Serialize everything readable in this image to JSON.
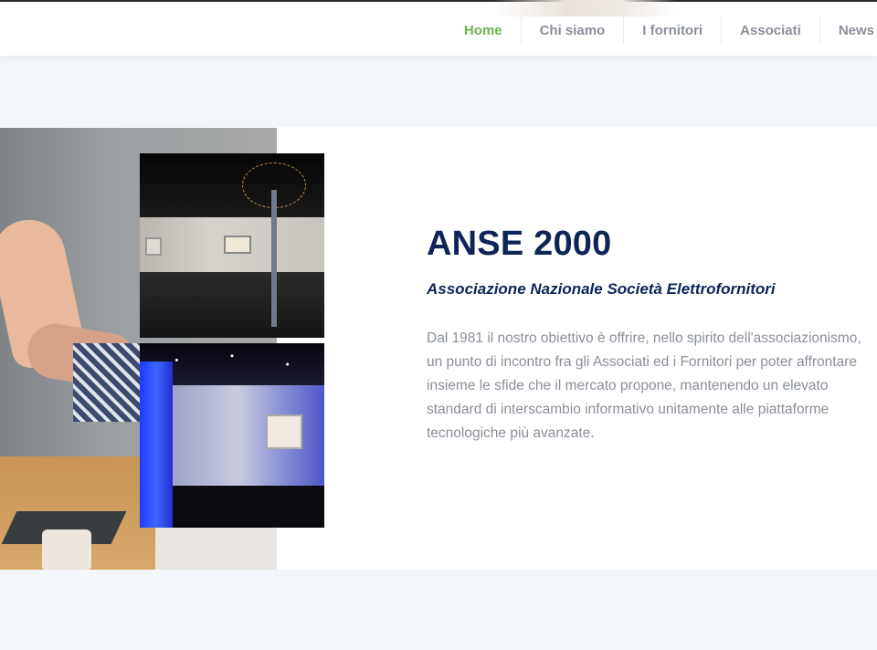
{
  "nav": {
    "items": [
      {
        "label": "Home",
        "active": true
      },
      {
        "label": "Chi siamo",
        "active": false
      },
      {
        "label": "I fornitori",
        "active": false
      },
      {
        "label": "Associati",
        "active": false
      },
      {
        "label": "News",
        "active": false
      }
    ],
    "active_color": "#6bb34d",
    "text_color": "#8a8f99"
  },
  "hero": {
    "title": "ANSE 2000",
    "subtitle": "Associazione Nazionale Società Elettrofornitori",
    "body": "Dal 1981 il nostro obiettivo è offrire, nello spirito dell'associazionismo, un punto di incontro fra gli Associati ed i Fornitori per poter affrontare insieme le sfide che il mercato propone, mantenendo un elevato standard di interscambio informativo unitamente alle piattaforme tecnologiche più avanzate.",
    "title_color": "#0f2557"
  },
  "images": {
    "main": "high-five-team-photo",
    "top": "showroom-chandelier-photo",
    "bottom": "showroom-blue-light-photo"
  }
}
